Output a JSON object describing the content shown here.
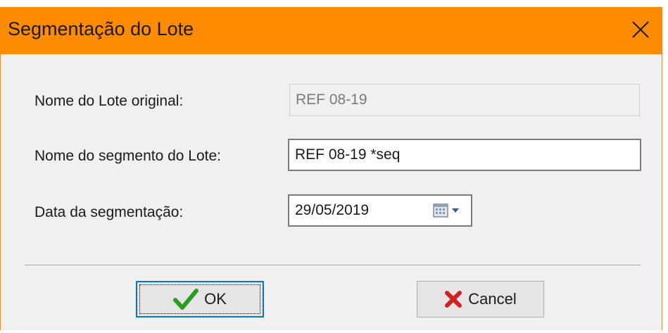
{
  "window": {
    "title": "Segmentação do Lote",
    "close_icon": "close-icon"
  },
  "form": {
    "original_label": "Nome do Lote original:",
    "original_value": "REF 08-19",
    "segment_label": "Nome do segmento do Lote:",
    "segment_value": "REF 08-19 *seq",
    "date_label": "Data da segmentação:",
    "date_value": "29/05/2019",
    "date_icon": "calendar-icon"
  },
  "buttons": {
    "ok_label": "OK",
    "ok_icon": "checkmark-icon",
    "cancel_label": "Cancel",
    "cancel_icon": "x-icon"
  },
  "colors": {
    "titlebar": "#ff8c00",
    "dialog_bg": "#f0f0f0",
    "ok_check": "#2a9d1e",
    "cancel_x": "#d42020",
    "focus_border": "#0078d7"
  }
}
